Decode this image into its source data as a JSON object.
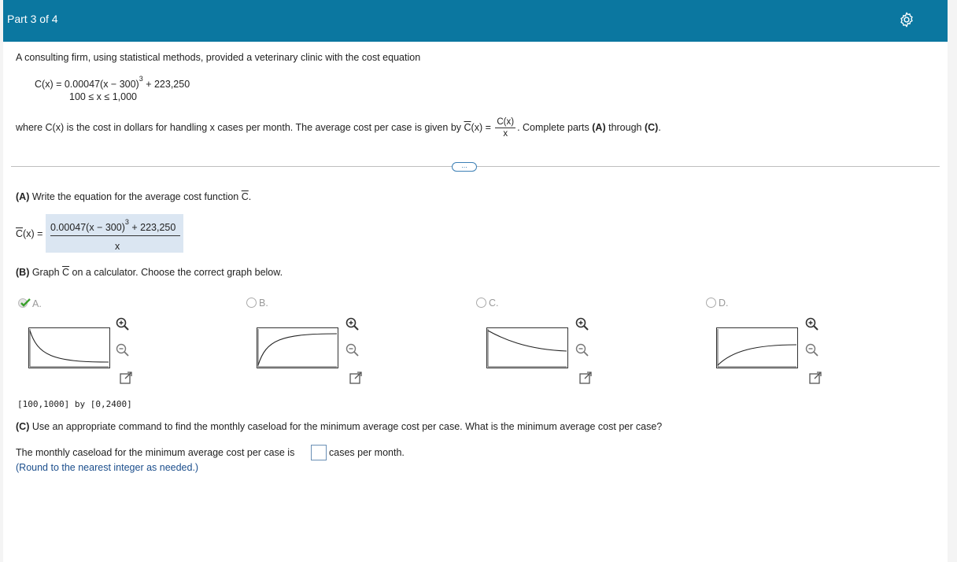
{
  "header": {
    "title": "Part 3 of 4",
    "settings_icon": "gear-icon"
  },
  "intro": {
    "text": "A consulting firm, using statistical methods, provided a veterinary clinic with the cost equation"
  },
  "equation": {
    "lhs": "C(x) = 0.00047(x − 300)",
    "exp": "3",
    "rhs": " + 223,250",
    "domain": "100 ≤ x ≤ 1,000"
  },
  "where": {
    "pre": "where C(x) is the cost in dollars for handling x cases per month. The average cost per case is given by ",
    "cbar": "C",
    "mid": "(x) = ",
    "num": "C(x)",
    "den": "x",
    "post": ". Complete parts ",
    "a": "(A)",
    "through": " through ",
    "c": "(C)",
    "end": "."
  },
  "more_button": "...",
  "partA": {
    "bold": "(A)",
    "text": " Write the equation for the average cost function ",
    "cbar": "C",
    "dot": ".",
    "answer_lhs_c": "C",
    "answer_lhs": "(x) =",
    "answer_num": "0.00047(x − 300)",
    "answer_exp": "3",
    "answer_num_tail": " + 223,250",
    "answer_den": "x"
  },
  "partB": {
    "bold": "(B)",
    "pre": " Graph ",
    "cbar": "C",
    "post": " on a calculator. Choose the correct graph below.",
    "choices": [
      {
        "label": "A.",
        "selected": true
      },
      {
        "label": "B.",
        "selected": false
      },
      {
        "label": "C.",
        "selected": false
      },
      {
        "label": "D.",
        "selected": false
      }
    ],
    "window": "[100,1000] by [0,2400]"
  },
  "partC": {
    "bold": "(C)",
    "text": " Use an appropriate command to find the monthly caseload for the minimum average cost per case. What is the minimum average cost per case?",
    "answer_pre": "The monthly caseload for the minimum average cost per case is",
    "answer_post": "cases per month.",
    "hint": "(Round to the nearest integer as needed.)"
  },
  "colors": {
    "header": "#0b77a0",
    "answer_bg": "#dbe6f2",
    "check": "#3aa02c"
  }
}
